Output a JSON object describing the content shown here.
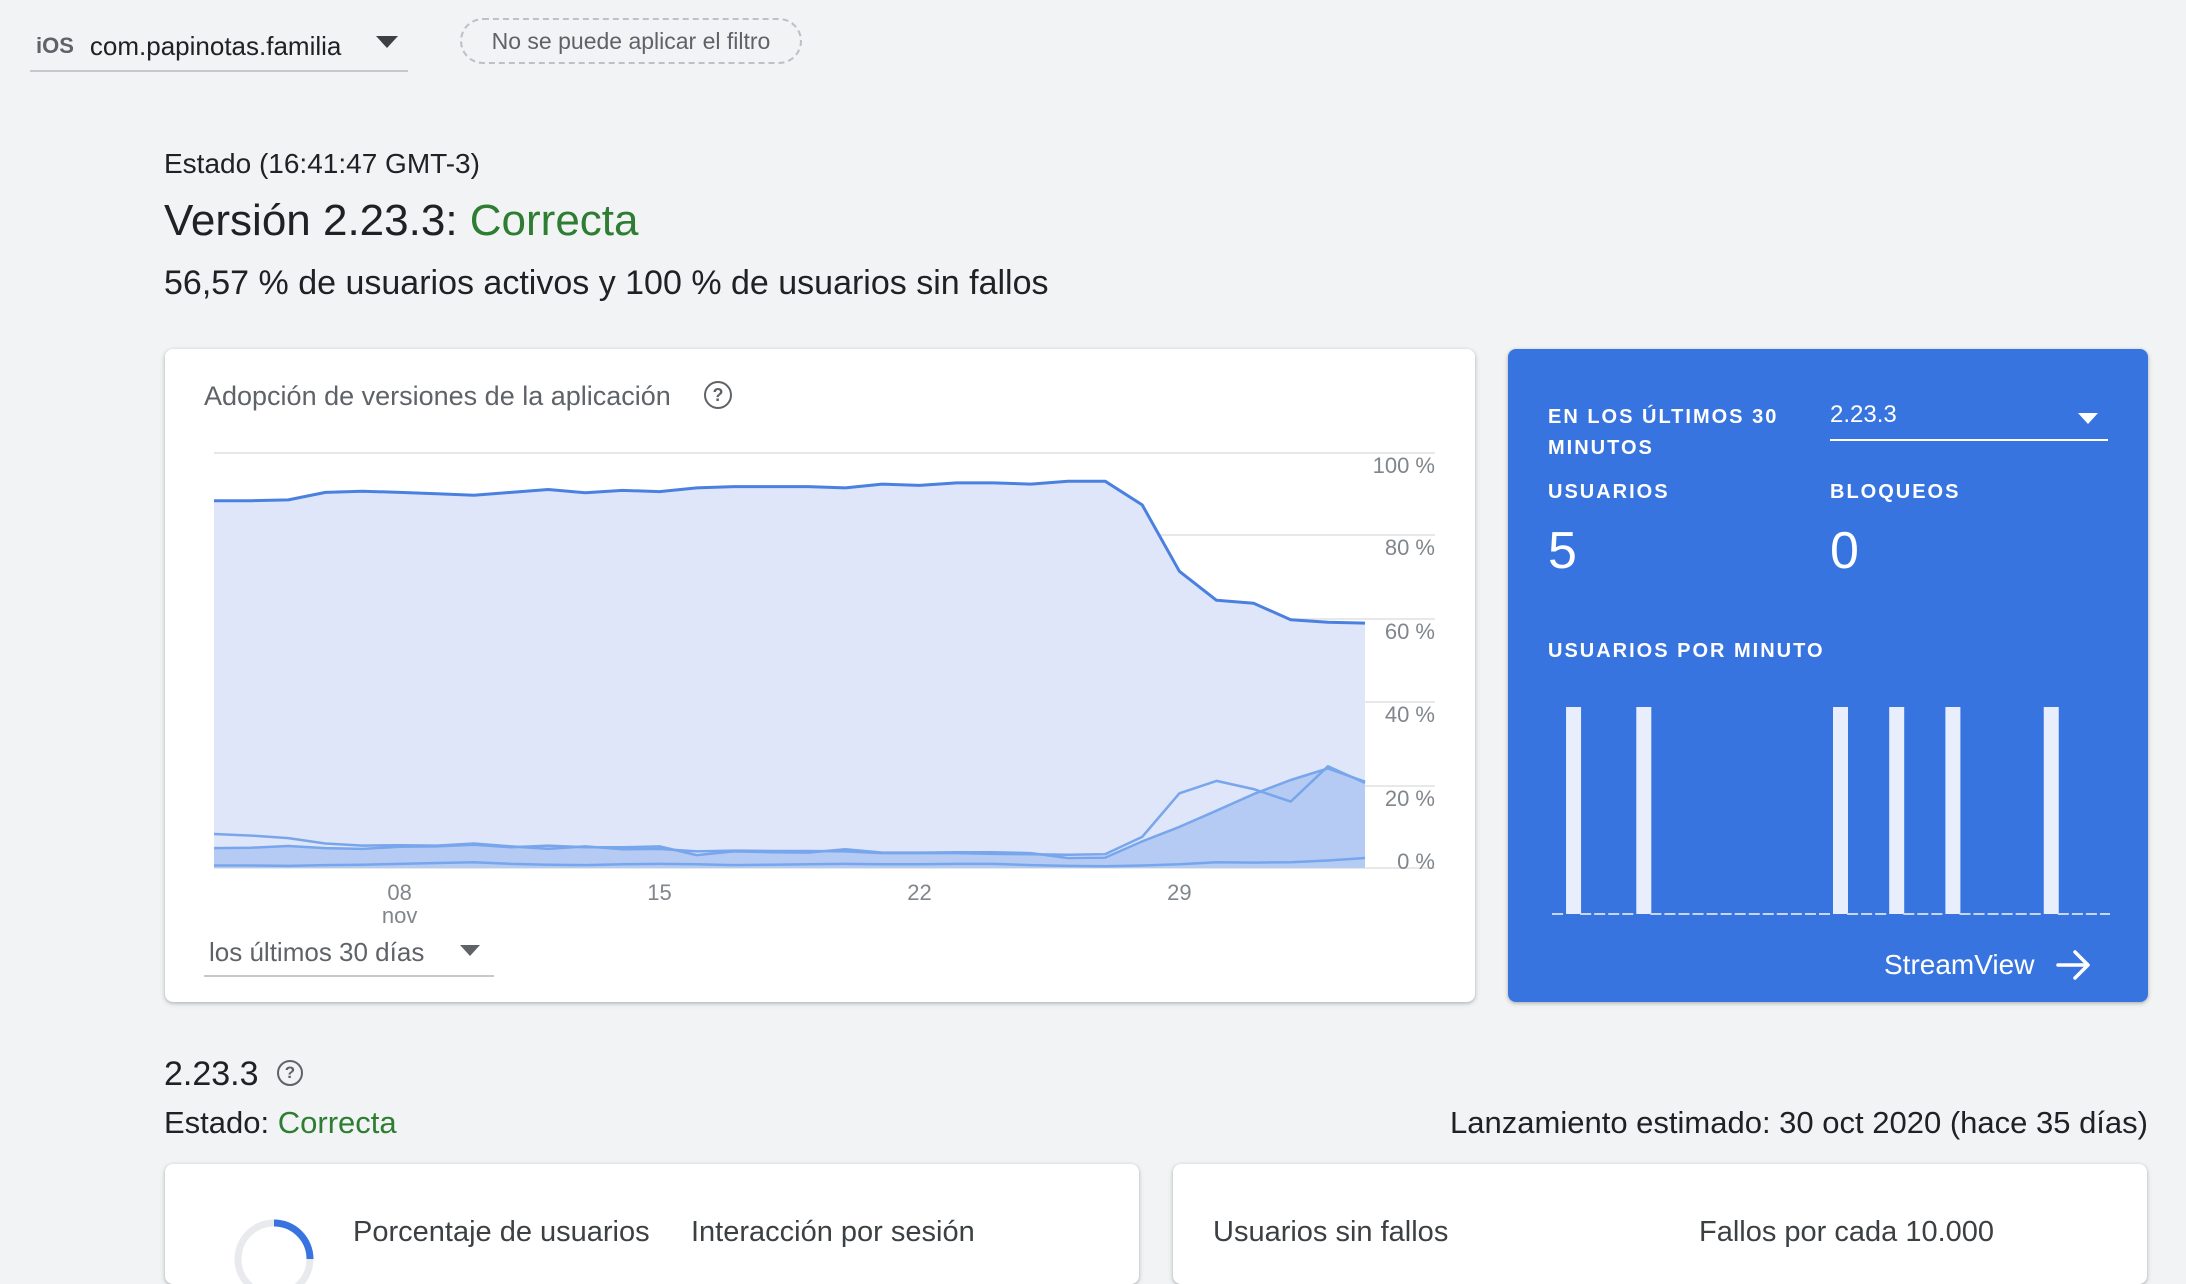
{
  "top_bar": {
    "platform": "iOS",
    "app_name": "com.papinotas.familia",
    "filter_chip": "No se puede aplicar el filtro"
  },
  "status": {
    "time": "Estado (16:41:47 GMT-3)",
    "version_prefix": "Versión 2.23.3:",
    "version_state": "Correcta",
    "summary": "56,57 % de usuarios activos y 100 % de usuarios sin fallos"
  },
  "adoption": {
    "title": "Adopción de versiones de la aplicación",
    "help_glyph": "?",
    "range": "los últimos 30 días"
  },
  "chart_data": {
    "type": "area",
    "title": "Adopción de versiones de la aplicación",
    "x": [
      "Nov 3",
      "Nov 4",
      "Nov 5",
      "Nov 6",
      "Nov 7",
      "Nov 8",
      "Nov 9",
      "Nov 10",
      "Nov 11",
      "Nov 12",
      "Nov 13",
      "Nov 14",
      "Nov 15",
      "Nov 16",
      "Nov 17",
      "Nov 18",
      "Nov 19",
      "Nov 20",
      "Nov 21",
      "Nov 22",
      "Nov 23",
      "Nov 24",
      "Nov 25",
      "Nov 26",
      "Nov 27",
      "Nov 28",
      "Nov 29",
      "Nov 30",
      "Dec 1",
      "Dec 2",
      "Dec 3",
      "Dec 4"
    ],
    "x_tick_labels": [
      {
        "x": "Nov 8",
        "label": "08",
        "sublabel": "nov"
      },
      {
        "x": "Nov 15",
        "label": "15",
        "sublabel": ""
      },
      {
        "x": "Nov 22",
        "label": "22",
        "sublabel": ""
      },
      {
        "x": "Nov 29",
        "label": "29",
        "sublabel": ""
      }
    ],
    "y_ticks": [
      "100 %",
      "80 %",
      "60 %",
      "40 %",
      "20 %",
      "0 %"
    ],
    "ylim": [
      0,
      100
    ],
    "grid": true,
    "series": [
      {
        "values": [
          88.5,
          88.5,
          88.7,
          90.5,
          90.8,
          90.5,
          90.2,
          89.8,
          90.5,
          91.2,
          90.4,
          91.0,
          90.7,
          91.6,
          91.9,
          91.9,
          91.9,
          91.6,
          92.5,
          92.2,
          92.8,
          92.8,
          92.5,
          93.2,
          93.2,
          87.5,
          71.5,
          64.5,
          63.8,
          59.8,
          59.2,
          59.0
        ]
      },
      {
        "values": [
          8.2,
          7.8,
          7.2,
          5.9,
          5.4,
          5.5,
          5.4,
          5.9,
          5.2,
          4.6,
          5.2,
          4.5,
          4.6,
          4.0,
          4.2,
          4.1,
          4.1,
          4.0,
          3.6,
          3.6,
          3.6,
          3.4,
          3.3,
          3.2,
          3.3,
          7.5,
          18.0,
          21.0,
          19.0,
          16.0,
          24.5,
          20.5
        ]
      },
      {
        "values": [
          4.8,
          4.9,
          5.3,
          4.8,
          4.6,
          5.1,
          5.2,
          5.6,
          5.0,
          5.4,
          5.0,
          5.0,
          5.2,
          3.1,
          4.0,
          3.8,
          3.7,
          4.5,
          3.7,
          3.7,
          3.8,
          3.8,
          3.6,
          2.4,
          2.5,
          6.4,
          9.9,
          13.8,
          17.8,
          21.2,
          24.0,
          20.8
        ]
      },
      {
        "values": [
          0.6,
          0.6,
          0.5,
          0.7,
          0.8,
          1.0,
          1.2,
          1.4,
          1.0,
          0.8,
          0.7,
          0.9,
          1.0,
          0.9,
          0.7,
          0.8,
          0.9,
          1.0,
          0.9,
          0.9,
          1.0,
          1.0,
          0.7,
          0.5,
          0.4,
          0.6,
          0.9,
          1.4,
          1.3,
          1.4,
          1.8,
          2.4
        ]
      }
    ],
    "colors": {
      "primary": "#4a80e0",
      "secondary": "#78a6ec",
      "fill": "#dfe6f9"
    }
  },
  "realtime": {
    "period_label": "EN LOS ÚLTIMOS 30 MINUTOS",
    "version": "2.23.3",
    "users_label": "USUARIOS",
    "users_value": "5",
    "crashes_label": "BLOQUEOS",
    "crashes_value": "0",
    "per_minute_label": "USUARIOS POR MINUTO",
    "per_minute": [
      0,
      1,
      0,
      0,
      0,
      0,
      1,
      0,
      0,
      0,
      0,
      0,
      0,
      0,
      0,
      0,
      0,
      0,
      0,
      0,
      1,
      0,
      0,
      0,
      1,
      0,
      0,
      0,
      1,
      0,
      0,
      0,
      0,
      0,
      0,
      1,
      0,
      0,
      0,
      0
    ],
    "link_label": "StreamView"
  },
  "version_section": {
    "title": "2.23.3",
    "status_prefix": "Estado:",
    "status_value": "Correcta",
    "release": "Lanzamiento estimado: 30 oct 2020 (hace 35 días)",
    "engagement_labels": [
      "Porcentaje de usuarios",
      "Interacción por sesión"
    ],
    "stability_labels": [
      "Usuarios sin fallos",
      "Fallos por cada 10.000"
    ]
  }
}
